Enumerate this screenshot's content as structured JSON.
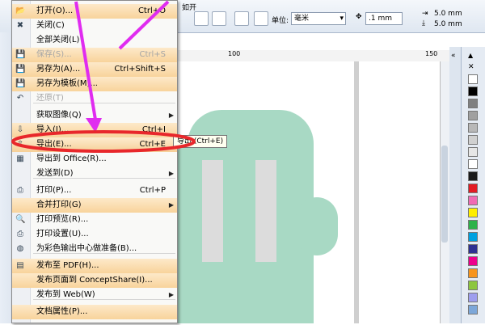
{
  "toolbar": {
    "menu_stub": "如开",
    "unit_label": "单位:",
    "unit_value": "毫米",
    "nudge_value": ".1 mm",
    "dup_x": "5.0 mm",
    "dup_y": "5.0 mm"
  },
  "ruler": {
    "ticks": [
      "100",
      "150"
    ]
  },
  "menu": {
    "items": [
      {
        "label": "打开(O)...",
        "shortcut": "Ctrl+O",
        "icon": "open-icon",
        "glyph": "📂",
        "hl": true
      },
      {
        "label": "关闭(C)",
        "shortcut": "",
        "icon": "close-doc-icon",
        "glyph": "✖"
      },
      {
        "label": "全部关闭(L)",
        "shortcut": "",
        "icon": "",
        "glyph": ""
      },
      {
        "label": "保存(S)...",
        "shortcut": "Ctrl+S",
        "icon": "save-icon",
        "glyph": "💾",
        "hl": true,
        "disabled": true
      },
      {
        "label": "另存为(A)...",
        "shortcut": "Ctrl+Shift+S",
        "icon": "save-as-icon",
        "glyph": "💾",
        "hl": true
      },
      {
        "label": "另存为模板(M)...",
        "shortcut": "",
        "icon": "save-template-icon",
        "glyph": "💾",
        "hl": true
      },
      {
        "label": "还原(T)",
        "shortcut": "",
        "icon": "revert-icon",
        "glyph": "↶",
        "disabled": true
      },
      {
        "label": "获取图像(Q)",
        "shortcut": "",
        "icon": "",
        "glyph": "",
        "submenu": true
      },
      {
        "label": "导入(I)...",
        "shortcut": "Ctrl+I",
        "icon": "import-icon",
        "glyph": "⇩",
        "hl": true
      },
      {
        "label": "导出(E)...",
        "shortcut": "Ctrl+E",
        "icon": "export-icon",
        "glyph": "⇧",
        "hl": true
      },
      {
        "label": "导出到 Office(R)...",
        "shortcut": "",
        "icon": "export-office-icon",
        "glyph": "▦"
      },
      {
        "label": "发送到(D)",
        "shortcut": "",
        "icon": "",
        "glyph": "",
        "submenu": true
      },
      {
        "label": "打印(P)...",
        "shortcut": "Ctrl+P",
        "icon": "print-icon",
        "glyph": "⎙"
      },
      {
        "label": "合并打印(G)",
        "shortcut": "",
        "icon": "",
        "glyph": "",
        "submenu": true,
        "hl": true
      },
      {
        "label": "打印预览(R)...",
        "shortcut": "",
        "icon": "print-preview-icon",
        "glyph": "🔍"
      },
      {
        "label": "打印设置(U)...",
        "shortcut": "",
        "icon": "print-setup-icon",
        "glyph": "⎙"
      },
      {
        "label": "为彩色输出中心做准备(B)...",
        "shortcut": "",
        "icon": "color-output-icon",
        "glyph": "◍"
      },
      {
        "label": "发布至 PDF(H)...",
        "shortcut": "",
        "icon": "pdf-icon",
        "glyph": "▤",
        "hl": true
      },
      {
        "label": "发布页面到 ConceptShare(I)...",
        "shortcut": "",
        "icon": "",
        "glyph": "",
        "hl": true
      },
      {
        "label": "发布到 Web(W)",
        "shortcut": "",
        "icon": "",
        "glyph": "",
        "submenu": true
      },
      {
        "label": "文档属性(P)...",
        "shortcut": "",
        "icon": "",
        "glyph": "",
        "hl": true
      }
    ]
  },
  "tooltip": "导出 (Ctrl+E)",
  "palette": {
    "colors": [
      "#ffffff",
      "#000000",
      "#808080",
      "#a0a0a0",
      "#b8b8b8",
      "#d0d0d0",
      "#e6e6e6",
      "#ffffff",
      "#1a1a1a",
      "#e21b23",
      "#f06ab4",
      "#ffef00",
      "#2db24a",
      "#00a1e0",
      "#2e3192",
      "#ec008c",
      "#f7941d",
      "#8dc63f",
      "#9e9eee",
      "#7da7d9"
    ]
  },
  "colors": {
    "accent": "#f8d39b",
    "annotation_arrow": "#e02cf0",
    "annotation_ellipse": "#e8272b",
    "shape": "#a8d9c4"
  }
}
